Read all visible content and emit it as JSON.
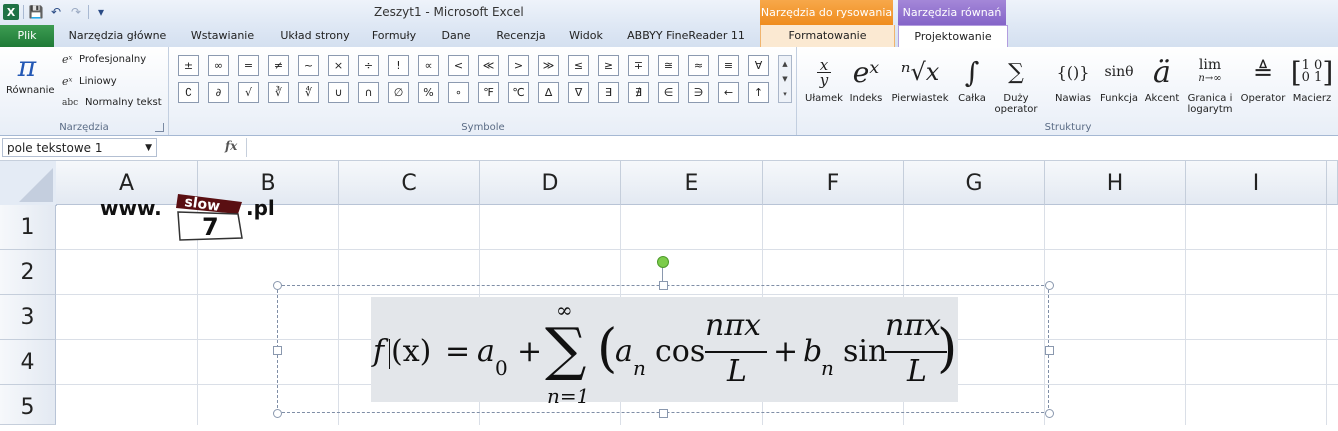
{
  "window": {
    "title": "Zeszyt1 - Microsoft Excel",
    "app_icon": "X",
    "accent_file_tab": "#1f7a37",
    "context_drawing_color": "#ef8c1e",
    "context_equation_color": "#8464c8"
  },
  "qat": {
    "save_icon": "💾",
    "undo_icon": "↶",
    "redo_icon": "↷",
    "more_icon": "▾"
  },
  "context_groups": {
    "drawing": "Narzędzia do rysowania",
    "equation": "Narzędzia równań"
  },
  "tabs": [
    {
      "label": "Plik"
    },
    {
      "label": "Narzędzia główne"
    },
    {
      "label": "Wstawianie"
    },
    {
      "label": "Układ strony"
    },
    {
      "label": "Formuły"
    },
    {
      "label": "Dane"
    },
    {
      "label": "Recenzja"
    },
    {
      "label": "Widok"
    },
    {
      "label": "ABBYY FineReader 11"
    },
    {
      "label": "Formatowanie"
    },
    {
      "label": "Projektowanie"
    }
  ],
  "ribbon": {
    "tools": {
      "equation_glyph": "π",
      "equation_label": "Równanie",
      "professional": "Profesjonalny",
      "linear": "Liniowy",
      "normal_text": "Normalny tekst",
      "normal_text_icon": "abc",
      "group_label": "Narzędzia"
    },
    "symbols": {
      "group_label": "Symbole",
      "row1": [
        "±",
        "∞",
        "=",
        "≠",
        "~",
        "×",
        "÷",
        "!",
        "∝",
        "<",
        "≪",
        ">",
        "≫",
        "≤",
        "≥",
        "∓",
        "≅",
        "≈",
        "≡",
        "∀"
      ],
      "row2": [
        "∁",
        "∂",
        "√",
        "∛",
        "∜",
        "∪",
        "∩",
        "∅",
        "%",
        "∘",
        "℉",
        "℃",
        "∆",
        "∇",
        "∃",
        "∄",
        "∈",
        "∋",
        "←",
        "↑"
      ]
    },
    "structures": {
      "group_label": "Struktury",
      "buttons": [
        {
          "glyph": "x/y",
          "label": "Ułamek"
        },
        {
          "glyph": "eˣ",
          "label": "Indeks"
        },
        {
          "glyph": "ⁿ√x",
          "label": "Pierwiastek"
        },
        {
          "glyph": "∫",
          "label": "Całka"
        },
        {
          "glyph": "∑",
          "label": "Duży operator"
        },
        {
          "glyph": "{()}",
          "label": "Nawias"
        },
        {
          "glyph": "sinθ",
          "label": "Funkcja"
        },
        {
          "glyph": "ä",
          "label": "Akcent"
        },
        {
          "glyph": "lim",
          "label": "Granica i logarytm"
        },
        {
          "glyph": "≜",
          "label": "Operator"
        },
        {
          "glyph": "[10;01]",
          "label": "Macierz"
        }
      ]
    }
  },
  "formula_bar": {
    "name_box": "pole tekstowe 1",
    "fx": "fx",
    "value": ""
  },
  "grid": {
    "columns": [
      "A",
      "B",
      "C",
      "D",
      "E",
      "F",
      "G",
      "H",
      "I"
    ],
    "rows": [
      "1",
      "2",
      "3",
      "4",
      "5"
    ]
  },
  "logo": {
    "prefix": "www.",
    "word": "slow",
    "number": "7",
    "suffix": ".pl"
  },
  "equation": {
    "f": "f",
    "x_paren": "(x)",
    "eq": "=",
    "a": "a",
    "zero": "0",
    "plus": "+",
    "sum": "∑",
    "sum_top": "∞",
    "sum_bottom": "n=1",
    "lparen": "(",
    "n": "n",
    "cos": "cos",
    "num": "nπx",
    "den": "L",
    "b": "b",
    "sin": "sin",
    "rparen": ")"
  }
}
